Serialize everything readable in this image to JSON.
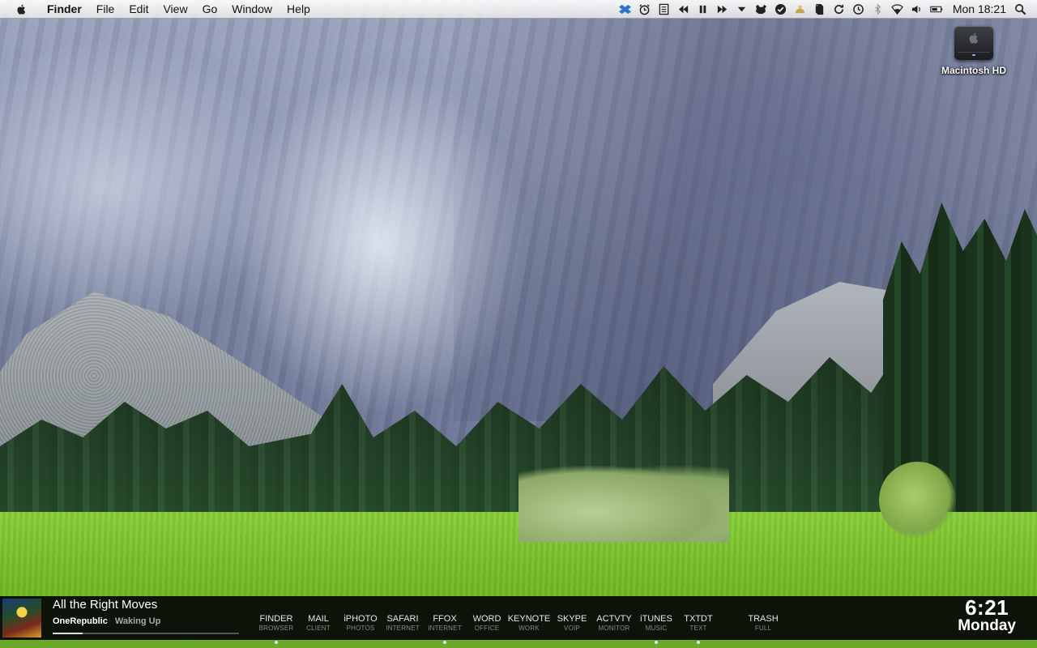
{
  "menubar": {
    "app_name": "Finder",
    "menus": [
      "File",
      "Edit",
      "View",
      "Go",
      "Window",
      "Help"
    ],
    "clock": "Mon 18:21",
    "status_icons": [
      "dropbox-icon",
      "alarm-clock-icon",
      "notes-icon",
      "media-prev-icon",
      "media-pause-icon",
      "media-next-icon",
      "dropdown-arrow-icon",
      "growl-icon",
      "checkmark-icon",
      "cloud-app-icon",
      "evernote-icon",
      "sync-icon",
      "time-machine-icon",
      "bluetooth-icon",
      "wifi-icon",
      "volume-icon",
      "battery-icon",
      "spotlight-icon"
    ]
  },
  "desktop": {
    "icons": [
      {
        "label": "Macintosh HD",
        "icon": "hard-drive-icon"
      }
    ]
  },
  "now_playing": {
    "title": "All the Right Moves",
    "artist": "OneRepublic",
    "album": "Waking Up",
    "progress": 0.16
  },
  "dock": {
    "items": [
      {
        "name": "FINDER",
        "sub": "BROWSER",
        "running": true
      },
      {
        "name": "MAIL",
        "sub": "CLIENT",
        "running": false
      },
      {
        "name": "iPHOTO",
        "sub": "PHOTOS",
        "running": false
      },
      {
        "name": "SAFARI",
        "sub": "INTERNET",
        "running": false
      },
      {
        "name": "FFOX",
        "sub": "INTERNET",
        "running": true
      },
      {
        "name": "WORD",
        "sub": "OFFICE",
        "running": false
      },
      {
        "name": "KEYNOTE",
        "sub": "WORK",
        "running": false
      },
      {
        "name": "SKYPE",
        "sub": "VOIP",
        "running": false
      },
      {
        "name": "ACTVTY",
        "sub": "MONITOR",
        "running": false
      },
      {
        "name": "iTUNES",
        "sub": "MUSIC",
        "running": true
      },
      {
        "name": "TXTDT",
        "sub": "TEXT",
        "running": true
      },
      {
        "name": "TRASH",
        "sub": "FULL",
        "running": false
      }
    ]
  },
  "widget_clock": {
    "time": "6:21",
    "day": "Monday"
  }
}
